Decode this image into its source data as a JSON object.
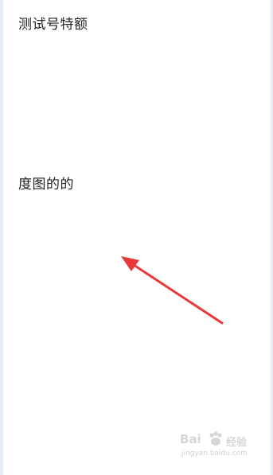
{
  "content": {
    "line1": "测试号特额",
    "line2": "度图的的"
  },
  "watermark": {
    "brand": "Bai",
    "sub": "经验",
    "url": "jingyan.baidu.com"
  },
  "colors": {
    "arrow": "#e8383a",
    "text": "#222222",
    "edge": "#e6ecf8"
  }
}
